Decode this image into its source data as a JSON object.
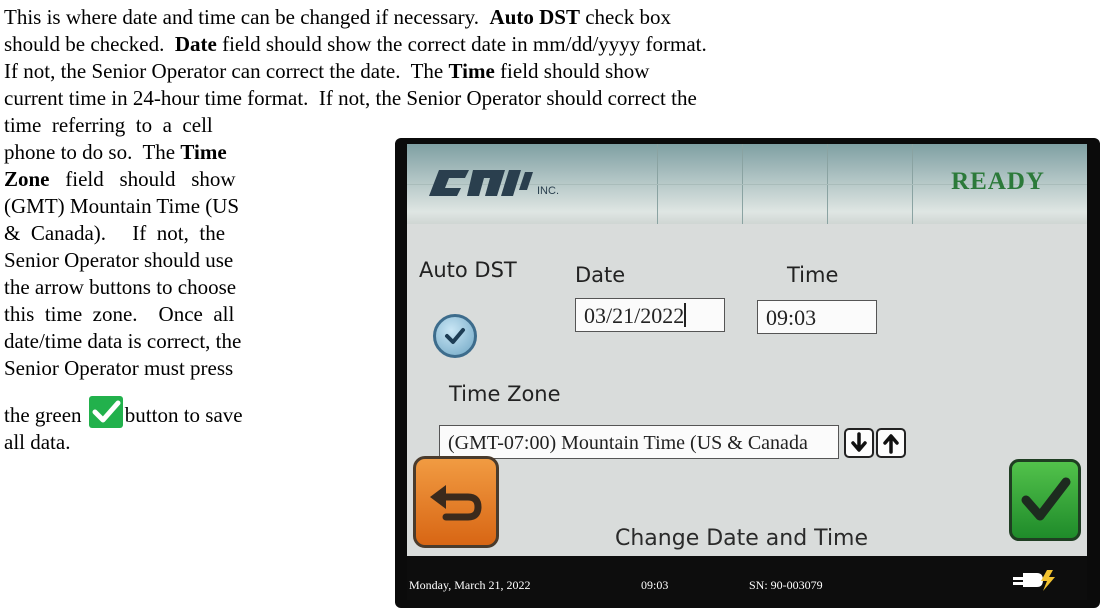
{
  "doc": {
    "top_lines": [
      [
        {
          "t": "This is where date and time can be changed if necessary.  ",
          "b": false
        },
        {
          "t": "Auto DST",
          "b": true
        },
        {
          "t": " check box",
          "b": false
        }
      ],
      [
        {
          "t": "should be checked.  ",
          "b": false
        },
        {
          "t": "Date",
          "b": true
        },
        {
          "t": " field should show the correct date in mm/dd/yyyy format.",
          "b": false
        }
      ],
      [
        {
          "t": "If not, the Senior Operator can correct the date.  The ",
          "b": false
        },
        {
          "t": "Time",
          "b": true
        },
        {
          "t": " field should show",
          "b": false
        }
      ],
      [
        {
          "t": "current time in 24-hour time format.  If not, the Senior Operator should correct the",
          "b": false
        }
      ]
    ],
    "left_lines": [
      [
        {
          "t": "time  referring  to  a  cell",
          "b": false
        }
      ],
      [
        {
          "t": "phone to do so.  The ",
          "b": false
        },
        {
          "t": "Time",
          "b": true
        }
      ],
      [
        {
          "t": "Zone",
          "b": true
        },
        {
          "t": "   field   should   show",
          "b": false
        }
      ],
      [
        {
          "t": "(GMT) Mountain Time (US",
          "b": false
        }
      ],
      [
        {
          "t": "&  Canada).     If  not,  the",
          "b": false
        }
      ],
      [
        {
          "t": "Senior Operator should use",
          "b": false
        }
      ],
      [
        {
          "t": "the arrow buttons to choose",
          "b": false
        }
      ],
      [
        {
          "t": "this  time  zone.    Once  all",
          "b": false
        }
      ],
      [
        {
          "t": "date/time data is correct, the",
          "b": false
        }
      ],
      [
        {
          "t": "Senior Operator must press",
          "b": false
        }
      ]
    ],
    "press_before": "the green ",
    "press_after": "button to save",
    "last_line": "all data."
  },
  "device": {
    "logo_suffix": "INC.",
    "status": "READY",
    "auto_dst_label": "Auto DST",
    "auto_dst_checked": true,
    "date_label": "Date",
    "date_value": "03/21/2022",
    "time_label": "Time",
    "time_value": "09:03",
    "time_zone_label": "Time Zone",
    "time_zone_value": "(GMT-07:00) Mountain Time (US & Canada",
    "screen_title": "Change Date and Time",
    "footer_date": "Monday, March 21, 2022",
    "footer_time": "09:03",
    "footer_sn": "SN: 90-003079"
  },
  "colors": {
    "ok_green": "#22b14c",
    "back_orange": "#e07a22",
    "ready_green": "#2c7a3a"
  },
  "icons": [
    "green-check-icon",
    "check-circle-icon",
    "down-arrow-icon",
    "up-arrow-icon",
    "back-arrow-icon",
    "power-plug-icon"
  ]
}
